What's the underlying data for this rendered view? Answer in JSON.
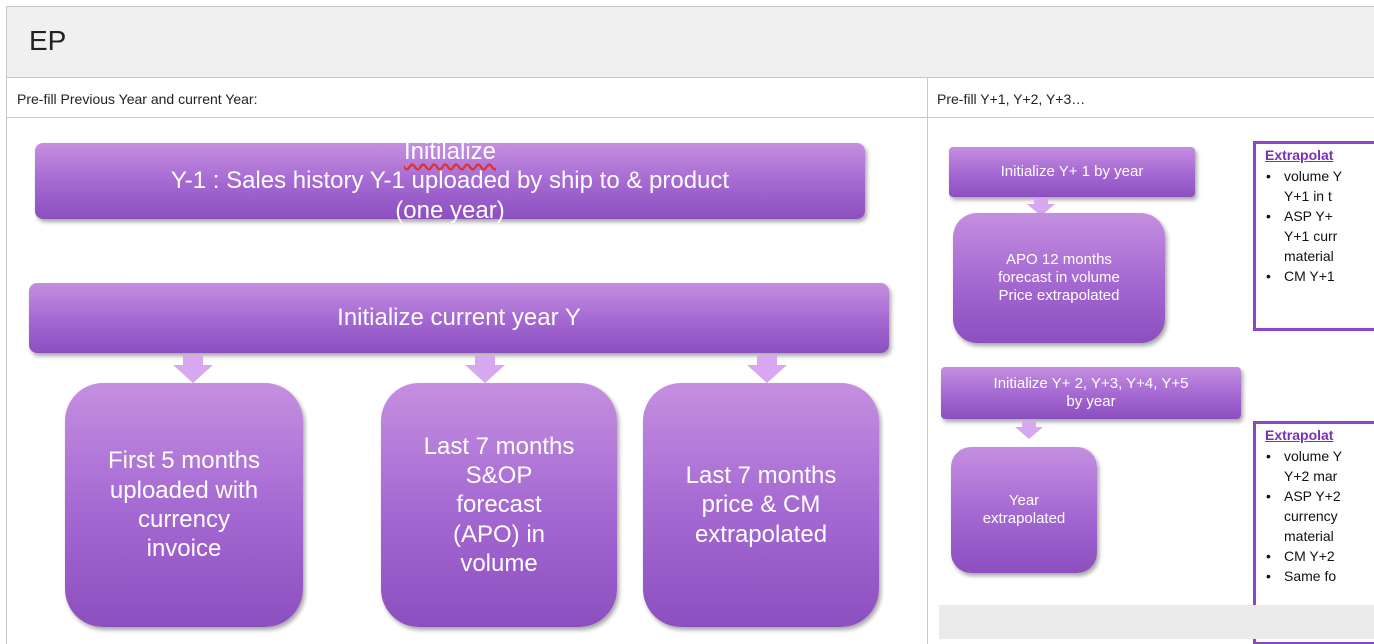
{
  "page": {
    "title": "EP"
  },
  "columns": {
    "left_header": "Pre-fill Previous Year and current Year:",
    "right_header": "Pre-fill Y+1, Y+2, Y+3…"
  },
  "left": {
    "init_y1_word": "Initilalize",
    "init_y1_rest_line1": " Y-1 : Sales  history Y-1 uploaded  by ship to & product",
    "init_y1_line2": "(one year)",
    "init_current": "Initialize  current year Y",
    "box1": [
      "First 5 months",
      "uploaded  with",
      "currency",
      "invoice"
    ],
    "box2": [
      "Last 7 months",
      "S&OP",
      "forecast",
      "(APO) in",
      "volume"
    ],
    "box3": [
      "Last 7 months",
      "price & CM",
      "extrapolated"
    ]
  },
  "right": {
    "init_y1": "Initialize Y+ 1 by year",
    "apo_box": [
      "APO 12 months",
      "forecast in volume",
      "Price extrapolated"
    ],
    "init_y2_line1": "Initialize Y+ 2, Y+3, Y+4, Y+5",
    "init_y2_line2": "by  year",
    "year_box": [
      "Year",
      "extrapolated"
    ],
    "panel1": {
      "title": "Extrapolat",
      "lines": [
        {
          "bullet": true,
          "text": "volume  Y"
        },
        {
          "bullet": false,
          "text": "Y+1 in t"
        },
        {
          "bullet": true,
          "text": "ASP Y+"
        },
        {
          "bullet": false,
          "text": "Y+1 curr"
        },
        {
          "bullet": false,
          "text": "material"
        },
        {
          "bullet": true,
          "text": "CM Y+1"
        }
      ]
    },
    "panel2": {
      "title": "Extrapolat",
      "lines": [
        {
          "bullet": true,
          "text": "volume  Y"
        },
        {
          "bullet": false,
          "text": "Y+2 mar"
        },
        {
          "bullet": true,
          "text": "ASP Y+2"
        },
        {
          "bullet": false,
          "text": "currency"
        },
        {
          "bullet": false,
          "text": "material"
        },
        {
          "bullet": true,
          "text": "CM Y+2"
        },
        {
          "bullet": true,
          "text": "Same fo"
        }
      ]
    }
  },
  "colors": {
    "box_top": "#c58fe0",
    "box_bottom": "#8c4fbf",
    "arrow": "#d7a7ef",
    "panel_border": "#8e44c9",
    "panel_title": "#7b2fb8"
  }
}
